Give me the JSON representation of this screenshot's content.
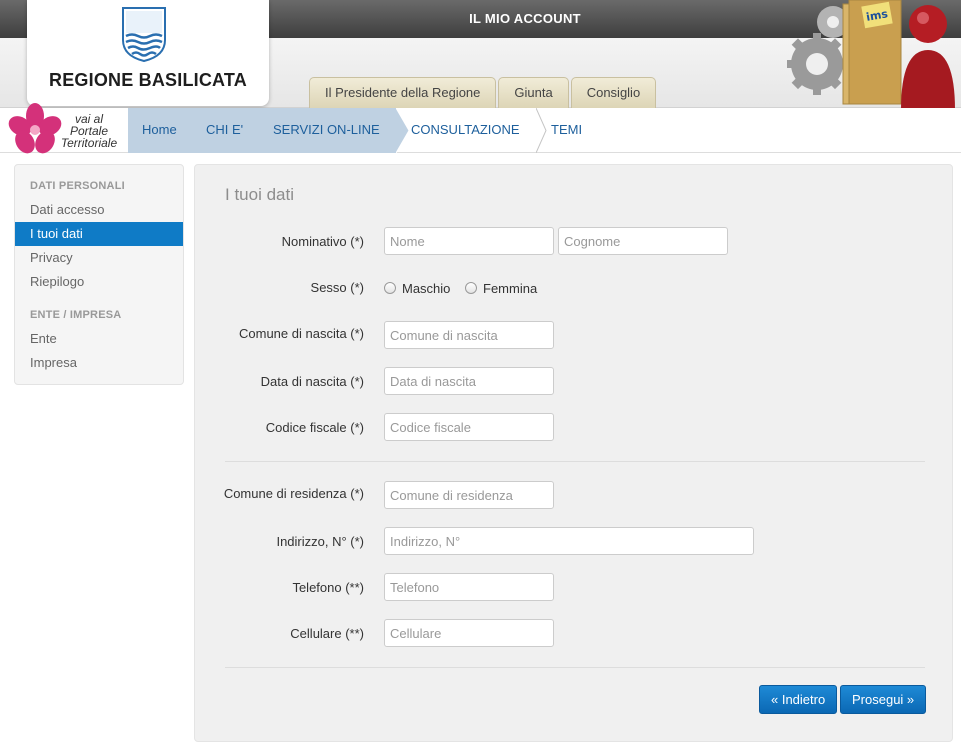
{
  "header": {
    "account_title": "IL MIO ACCOUNT",
    "logo_text": "REGIONE BASILICATA",
    "tabs": [
      {
        "label": "Il Presidente della Regione"
      },
      {
        "label": "Giunta"
      },
      {
        "label": "Consiglio"
      }
    ],
    "ims_label": "ims"
  },
  "portal_link": {
    "line1": "vai al",
    "line2": "Portale",
    "line3": "Territoriale"
  },
  "breadcrumb": [
    {
      "label": "Home"
    },
    {
      "label": "CHI E'"
    },
    {
      "label": "SERVIZI ON-LINE"
    },
    {
      "label": "CONSULTAZIONE"
    },
    {
      "label": "TEMI"
    }
  ],
  "sidebar": {
    "section1_title": "DATI PERSONALI",
    "section1_items": [
      "Dati accesso",
      "I tuoi dati",
      "Privacy",
      "Riepilogo"
    ],
    "active_item": "I tuoi dati",
    "section2_title": "ENTE / IMPRESA",
    "section2_items": [
      "Ente",
      "Impresa"
    ]
  },
  "form": {
    "title": "I tuoi dati",
    "nominativo": {
      "label": "Nominativo (*)",
      "nome_placeholder": "Nome",
      "cognome_placeholder": "Cognome"
    },
    "sesso": {
      "label": "Sesso (*)",
      "options": [
        "Maschio",
        "Femmina"
      ]
    },
    "comune_nascita": {
      "label": "Comune di nascita (*)",
      "placeholder": "Comune di nascita"
    },
    "data_nascita": {
      "label": "Data di nascita (*)",
      "placeholder": "Data di nascita"
    },
    "codice_fiscale": {
      "label": "Codice fiscale (*)",
      "placeholder": "Codice fiscale"
    },
    "comune_residenza": {
      "label": "Comune di residenza (*)",
      "placeholder": "Comune di residenza"
    },
    "indirizzo": {
      "label": "Indirizzo, N° (*)",
      "placeholder": "Indirizzo, N°"
    },
    "telefono": {
      "label": "Telefono (**)",
      "placeholder": "Telefono"
    },
    "cellulare": {
      "label": "Cellulare (**)",
      "placeholder": "Cellulare"
    },
    "back_button": "« Indietro",
    "next_button": "Prosegui »"
  },
  "colors": {
    "accent_blue": "#0f7bc6",
    "tab_beige": "#e6dfc4",
    "crumb_blue": "#bfd1e2"
  }
}
